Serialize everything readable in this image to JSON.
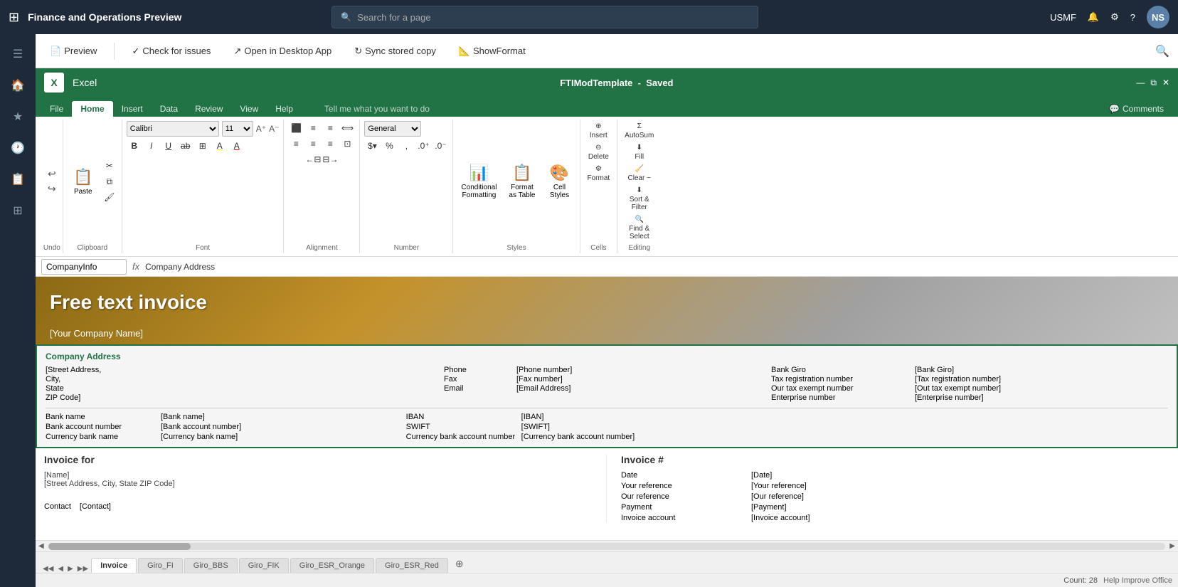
{
  "topnav": {
    "app_grid_icon": "⊞",
    "title": "Finance and Operations Preview",
    "search_placeholder": "Search for a page",
    "user": "USMF",
    "bell_icon": "🔔",
    "gear_icon": "⚙",
    "help_icon": "?",
    "avatar": "NS"
  },
  "sidenav": {
    "icons": [
      "☰",
      "🏠",
      "★",
      "🕐",
      "📋",
      "☰"
    ]
  },
  "commandbar": {
    "preview_label": "Preview",
    "check_issues_label": "Check for issues",
    "open_desktop_label": "Open in Desktop App",
    "sync_copy_label": "Sync stored copy",
    "show_format_label": "ShowFormat"
  },
  "excel": {
    "logo": "X",
    "app_name": "Excel",
    "file_title": "FTIModTemplate",
    "saved_label": "Saved",
    "window_min": "—",
    "window_restore": "⧉",
    "window_close": "✕"
  },
  "ribbon": {
    "tabs": [
      "File",
      "Home",
      "Insert",
      "Data",
      "Review",
      "View",
      "Help"
    ],
    "active_tab": "Home",
    "tell_me": "Tell me what you want to do",
    "comments_label": "Comments",
    "groups": {
      "undo": {
        "label": "Undo",
        "undo_icon": "↩",
        "redo_icon": "↪"
      },
      "clipboard": {
        "label": "Clipboard",
        "paste": "Paste",
        "cut": "✂",
        "copy": "⧉",
        "format_painter": "🖌"
      },
      "font": {
        "label": "Font",
        "font_name": "Calibri",
        "font_size": "11",
        "grow_icon": "A⁺",
        "shrink_icon": "A⁻",
        "bold": "B",
        "italic": "I",
        "underline": "U",
        "strikethrough": "ab",
        "border": "⊞",
        "fill": "A",
        "color": "A"
      },
      "alignment": {
        "label": "Alignment",
        "wrap": "⟺",
        "merge": "⊡"
      },
      "number": {
        "label": "Number",
        "format": "General",
        "currency": "$",
        "percent": "%",
        "comma": ",",
        "increase": ".00→.0",
        "decrease": ".0→.00"
      },
      "styles": {
        "label": "Styles",
        "conditional": "Conditional\nFormatting",
        "format_table": "Format\nas Table",
        "cell_styles": "Cell\nStyles"
      },
      "cells": {
        "label": "Cells",
        "insert": "Insert",
        "delete": "Delete",
        "format": "Format"
      },
      "editing": {
        "label": "Editing",
        "autosum": "AutoSum",
        "fill": "Fill",
        "clear": "Clear ~",
        "sort": "Sort &\nFilter",
        "find": "Find &\nSelect"
      }
    }
  },
  "formulabar": {
    "name_box": "CompanyInfo",
    "fx": "fx",
    "formula": "Company Address"
  },
  "invoice": {
    "header_title": "Free text invoice",
    "company_name": "[Your Company Name]",
    "company_address_label": "Company Address",
    "address_lines": [
      "[Street Address,",
      "City,",
      "State",
      "ZIP Code]"
    ],
    "contact_fields": [
      {
        "label": "Phone",
        "value": "[Phone number]"
      },
      {
        "label": "Fax",
        "value": "[Fax number]"
      },
      {
        "label": "Email",
        "value": "[Email Address]"
      }
    ],
    "bank_fields_left": [
      {
        "label": "Bank Giro",
        "value": "[Bank Giro]"
      },
      {
        "label": "Tax registration number",
        "value": "[Tax registration number]"
      },
      {
        "label": "Our tax exempt number",
        "value": "[Out tax exempt number]"
      },
      {
        "label": "Enterprise number",
        "value": "[Enterprise number]"
      }
    ],
    "bank_rows": [
      {
        "label": "Bank name",
        "value": "[Bank name]",
        "label2": "IBAN",
        "value2": "[IBAN]"
      },
      {
        "label": "Bank account number",
        "value": "[Bank account number]",
        "label2": "SWIFT",
        "value2": "[SWIFT]"
      },
      {
        "label": "Currency bank name",
        "value": "[Currency bank name]",
        "label2": "Currency bank account number",
        "value2": "[Currency bank account number]"
      }
    ],
    "invoice_for_label": "Invoice for",
    "invoice_for_name": "[Name]",
    "invoice_for_address": "[Street Address, City, State ZIP Code]",
    "invoice_for_contact_label": "Contact",
    "invoice_for_contact_value": "[Contact]",
    "invoice_num_label": "Invoice #",
    "invoice_detail_fields": [
      {
        "label": "Date",
        "value": "[Date]"
      },
      {
        "label": "Your reference",
        "value": "[Your reference]"
      },
      {
        "label": "Our reference",
        "value": "[Our reference]"
      },
      {
        "label": "Payment",
        "value": "[Payment]"
      },
      {
        "label": "Invoice account",
        "value": "[Invoice account]"
      }
    ]
  },
  "sheettabs": {
    "tabs": [
      "Invoice",
      "Giro_FI",
      "Giro_BBS",
      "Giro_FIK",
      "Giro_ESR_Orange",
      "Giro_ESR_Red"
    ],
    "active": "Invoice"
  },
  "statusbar": {
    "count_label": "Count: 28",
    "help_label": "Help Improve Office"
  }
}
